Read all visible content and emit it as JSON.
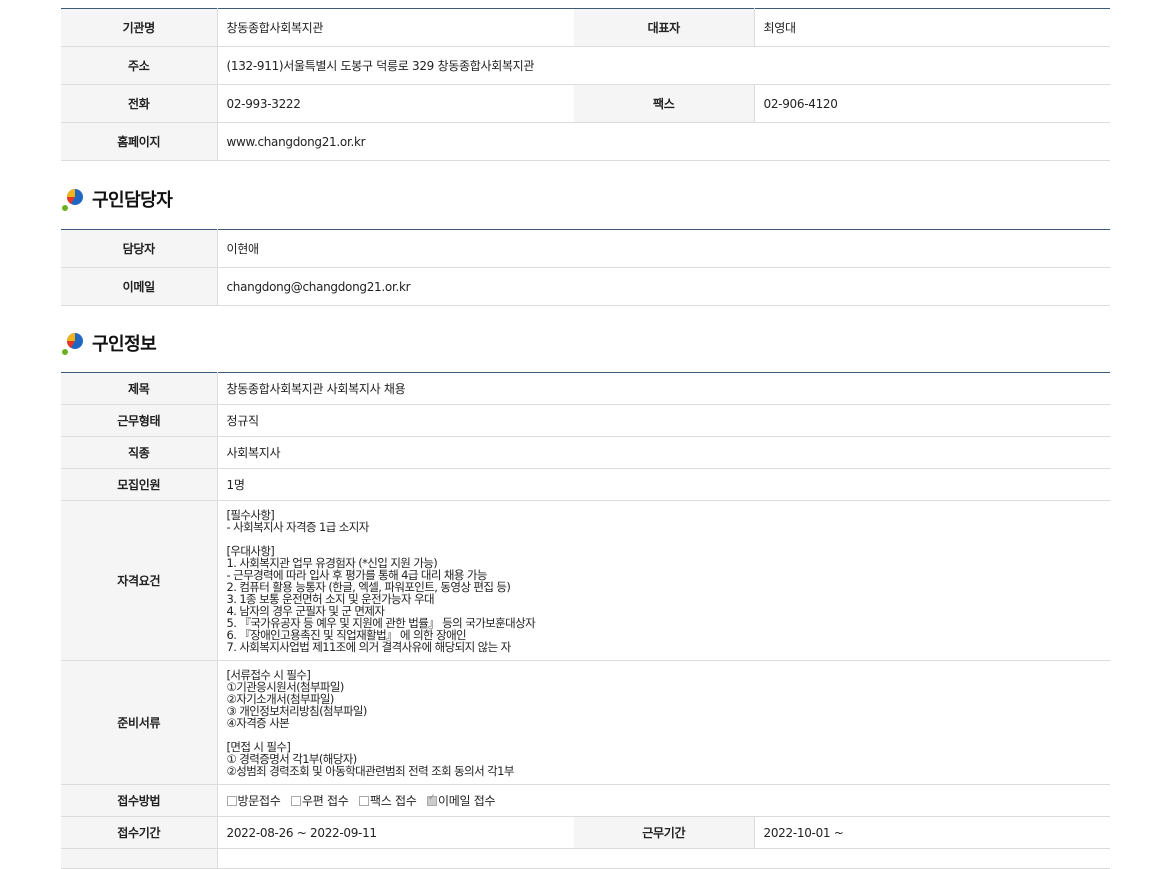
{
  "org": {
    "name_label": "기관명",
    "name": "창동종합사회복지관",
    "rep_label": "대표자",
    "rep": "최영대",
    "addr_label": "주소",
    "addr": "(132-911)서울특별시 도봉구 덕릉로 329 창동종합사회복지관",
    "phone_label": "전화",
    "phone": "02-993-3222",
    "fax_label": "팩스",
    "fax": "02-906-4120",
    "home_label": "홈페이지",
    "home": "www.changdong21.or.kr"
  },
  "contact": {
    "title": "구인담당자",
    "person_label": "담당자",
    "person": "이현애",
    "email_label": "이메일",
    "email": "changdong@changdong21.or.kr"
  },
  "job": {
    "title": "구인정보",
    "subject_label": "제목",
    "subject": "창동종합사회복지관 사회복지사 채용",
    "type_label": "근무형태",
    "type": "정규직",
    "category_label": "직종",
    "category": "사회복지사",
    "count_label": "모집인원",
    "count": "1명",
    "qual_label": "자격요건",
    "qual": "[필수사항]\n- 사회복지사 자격증 1급 소지자\n\n[우대사항]\n1. 사회복지관 업무 유경험자 (*신입 지원 가능)\n - 근무경력에 따라 입사 후 평가를 통해 4급 대리 채용 가능\n2. 컴퓨터 활용 능통자 (한글, 엑셀, 파워포인트, 동영상 편집 등)\n3. 1종 보통 운전면허 소지 및 운전가능자 우대\n4. 남자의 경우 군필자 및 군 면제자\n5. 『국가유공자 등 예우 및 지원에 관한 법률』 등의 국가보훈대상자\n6. 『장애인고용촉진 및 직업재활법』 에 의한 장애인\n7. 사회복지사업법 제11조에 의거 결격사유에 해당되지 않는 자",
    "docs_label": "준비서류",
    "docs": " [서류접수 시 필수]\n①기관응시원서(첨부파일)\n②자기소개서(첨부파일)\n③ 개인정보처리방침(첨부파일)\n④자격증 사본\n\n[면접 시 필수]\n① 경력증명서 각1부(해당자)\n②성범죄 경력조회 및 아동학대관련범죄 전력 조회 동의서  각1부",
    "method_label": "접수방법",
    "methods": [
      {
        "label": "방문접수",
        "checked": false
      },
      {
        "label": "우편 접수",
        "checked": false
      },
      {
        "label": "팩스 접수",
        "checked": false
      },
      {
        "label": "이메일 접수",
        "checked": true
      }
    ],
    "period_label": "접수기간",
    "period": "2022-08-26 ~ 2022-09-11",
    "work_period_label": "근무기간",
    "work_period": "2022-10-01 ~"
  }
}
